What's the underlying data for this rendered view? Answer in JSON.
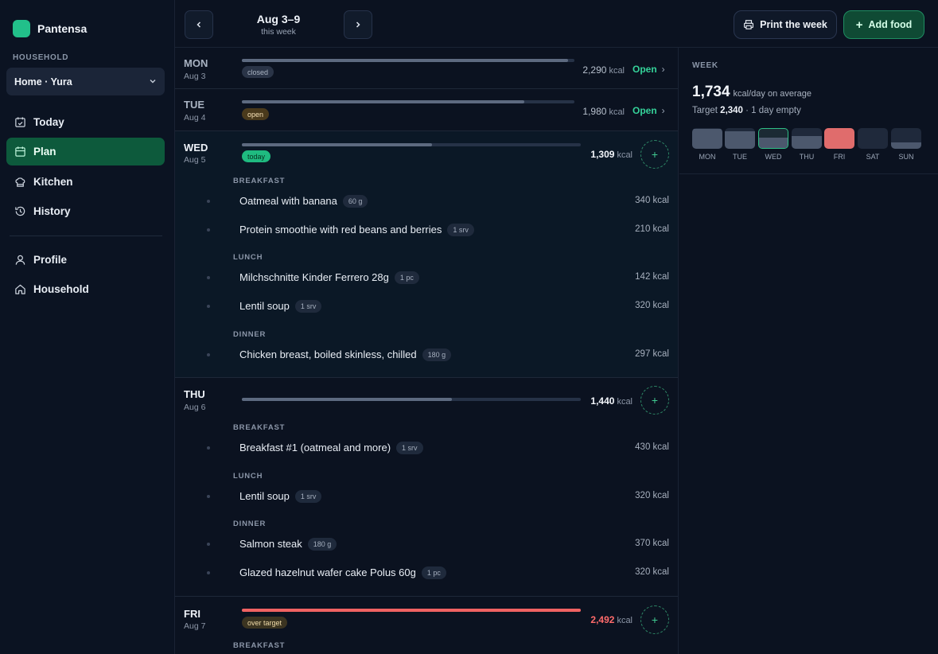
{
  "brand": {
    "name": "Pantensa"
  },
  "sidebar": {
    "household_label": "HOUSEHOLD",
    "household_select": "Home · Yura",
    "nav": [
      {
        "label": "Today",
        "icon": "calendar-check-icon"
      },
      {
        "label": "Plan",
        "icon": "calendar-icon",
        "active": true
      },
      {
        "label": "Kitchen",
        "icon": "chef-hat-icon"
      },
      {
        "label": "History",
        "icon": "history-icon"
      },
      {
        "label": "Profile",
        "icon": "user-icon"
      },
      {
        "label": "Household",
        "icon": "home-icon"
      }
    ]
  },
  "header": {
    "week_range": "Aug 3–9",
    "week_sub": "this week",
    "print_label": "Print the week",
    "add_label": "Add food"
  },
  "days": [
    {
      "name": "MON",
      "date": "Aug 3",
      "status": "closed",
      "kcal": "2,290",
      "unit": "kcal",
      "link": "Open",
      "progress": 0.98
    },
    {
      "name": "TUE",
      "date": "Aug 4",
      "status": "open",
      "kcal": "1,980",
      "unit": "kcal",
      "link": "Open",
      "progress": 0.85
    },
    {
      "name": "WED",
      "date": "Aug 5",
      "status": "today",
      "kcal": "1,309",
      "unit": "kcal",
      "progress": 0.56,
      "meals": [
        {
          "label": "BREAKFAST",
          "items": [
            {
              "name": "Oatmeal with banana",
              "qty": "60 g",
              "kcal": "340 kcal"
            },
            {
              "name": "Protein smoothie with red beans and berries",
              "qty": "1 srv",
              "kcal": "210 kcal"
            }
          ]
        },
        {
          "label": "LUNCH",
          "items": [
            {
              "name": "Milchschnitte Kinder Ferrero 28g",
              "qty": "1 pc",
              "kcal": "142 kcal"
            },
            {
              "name": "Lentil soup",
              "qty": "1 srv",
              "kcal": "320 kcal"
            }
          ]
        },
        {
          "label": "DINNER",
          "items": [
            {
              "name": "Chicken breast, boiled skinless, chilled",
              "qty": "180 g",
              "kcal": "297 kcal"
            }
          ]
        }
      ]
    },
    {
      "name": "THU",
      "date": "Aug 6",
      "kcal": "1,440",
      "unit": "kcal",
      "progress": 0.62,
      "meals": [
        {
          "label": "BREAKFAST",
          "items": [
            {
              "name": "Breakfast #1 (oatmeal and more)",
              "qty": "1 srv",
              "kcal": "430 kcal"
            }
          ]
        },
        {
          "label": "LUNCH",
          "items": [
            {
              "name": "Lentil soup",
              "qty": "1 srv",
              "kcal": "320 kcal"
            }
          ]
        },
        {
          "label": "DINNER",
          "items": [
            {
              "name": "Salmon steak",
              "qty": "180 g",
              "kcal": "370 kcal"
            },
            {
              "name": "Glazed hazelnut wafer cake Polus 60g",
              "qty": "1 pc",
              "kcal": "320 kcal"
            }
          ]
        }
      ]
    },
    {
      "name": "FRI",
      "date": "Aug 7",
      "status": "over target",
      "kcal": "2,492",
      "unit": "kcal",
      "progress": 1.0,
      "meals": [
        {
          "label": "BREAKFAST",
          "items": []
        }
      ]
    }
  ],
  "week_summary": {
    "label": "WEEK",
    "avg": "1,734",
    "avg_suffix": "kcal/day on average",
    "target_prefix": "Target",
    "target_value": "2,340",
    "target_suffix": "· 1 day empty",
    "days": [
      {
        "label": "MON",
        "level": 0.98
      },
      {
        "label": "TUE",
        "level": 0.85
      },
      {
        "label": "WED",
        "level": 0.56,
        "current": true
      },
      {
        "label": "THU",
        "level": 0.62
      },
      {
        "label": "FRI",
        "level": 1.0,
        "over": true
      },
      {
        "label": "SAT",
        "level": 0
      },
      {
        "label": "SUN",
        "level": 0.3
      }
    ]
  },
  "colors": {
    "accent": "#22c08a",
    "over": "#f06262",
    "background": "#0b1220"
  }
}
